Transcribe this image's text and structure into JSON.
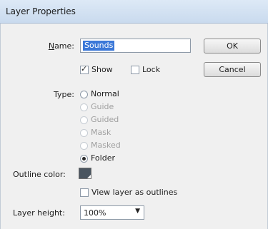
{
  "dialog": {
    "title": "Layer Properties"
  },
  "name": {
    "label": "Name:",
    "value": "Sounds"
  },
  "buttons": {
    "ok": "OK",
    "cancel": "Cancel"
  },
  "options": {
    "show": {
      "label": "Show",
      "checked": true
    },
    "lock": {
      "label": "Lock",
      "checked": false
    }
  },
  "type": {
    "label": "Type:",
    "items": [
      {
        "label": "Normal",
        "enabled": true,
        "selected": false
      },
      {
        "label": "Guide",
        "enabled": false,
        "selected": false
      },
      {
        "label": "Guided",
        "enabled": false,
        "selected": false
      },
      {
        "label": "Mask",
        "enabled": false,
        "selected": false
      },
      {
        "label": "Masked",
        "enabled": false,
        "selected": false
      },
      {
        "label": "Folder",
        "enabled": true,
        "selected": true
      }
    ]
  },
  "outline": {
    "label": "Outline color:",
    "color": "#4a5560"
  },
  "view_outlines": {
    "label": "View layer as outlines",
    "checked": false
  },
  "layer_height": {
    "label": "Layer height:",
    "value": "100%"
  }
}
